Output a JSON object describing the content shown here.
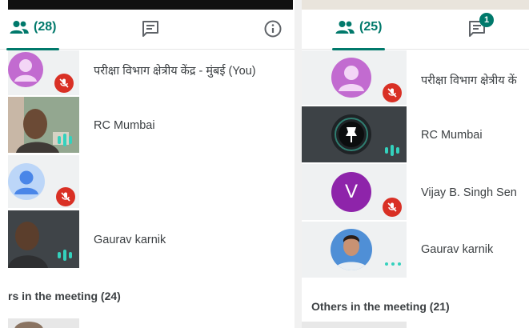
{
  "left_panel": {
    "tabs": {
      "people_count": "(28)",
      "chat_icon": "chat-icon",
      "info_icon": "info-icon"
    },
    "participants": [
      {
        "name": "परीक्षा विभाग क्षेत्रीय केंद्र - मुंबई (You)",
        "avatar": "default-person",
        "status": "muted"
      },
      {
        "name": "RC Mumbai",
        "avatar": "camera-video",
        "status": "speaking"
      },
      {
        "name": "",
        "avatar": "default-person-blue",
        "status": "muted"
      },
      {
        "name": "Gaurav karnik",
        "avatar": "camera-video-dark",
        "status": "speaking"
      }
    ],
    "others_heading": "rs in the meeting (24)"
  },
  "right_panel": {
    "tabs": {
      "people_count": "(25)",
      "chat_icon": "chat-icon",
      "chat_badge": "1"
    },
    "participants": [
      {
        "name": "परीक्षा विभाग क्षेत्रीय कें",
        "avatar": "default-person",
        "status": "muted"
      },
      {
        "name": "RC Mumbai",
        "avatar": "pin-icon",
        "status": "speaking"
      },
      {
        "name": "Vijay B. Singh Sen",
        "avatar_letter": "V",
        "status": "muted"
      },
      {
        "name": "Gaurav karnik",
        "avatar": "photo",
        "status": "more"
      }
    ],
    "others_heading": "Others in the meeting (21)"
  },
  "colors": {
    "accent": "#00796b",
    "mute": "#d93025",
    "speaking": "#34d1bd",
    "avatar_purple": "#8e24aa"
  }
}
